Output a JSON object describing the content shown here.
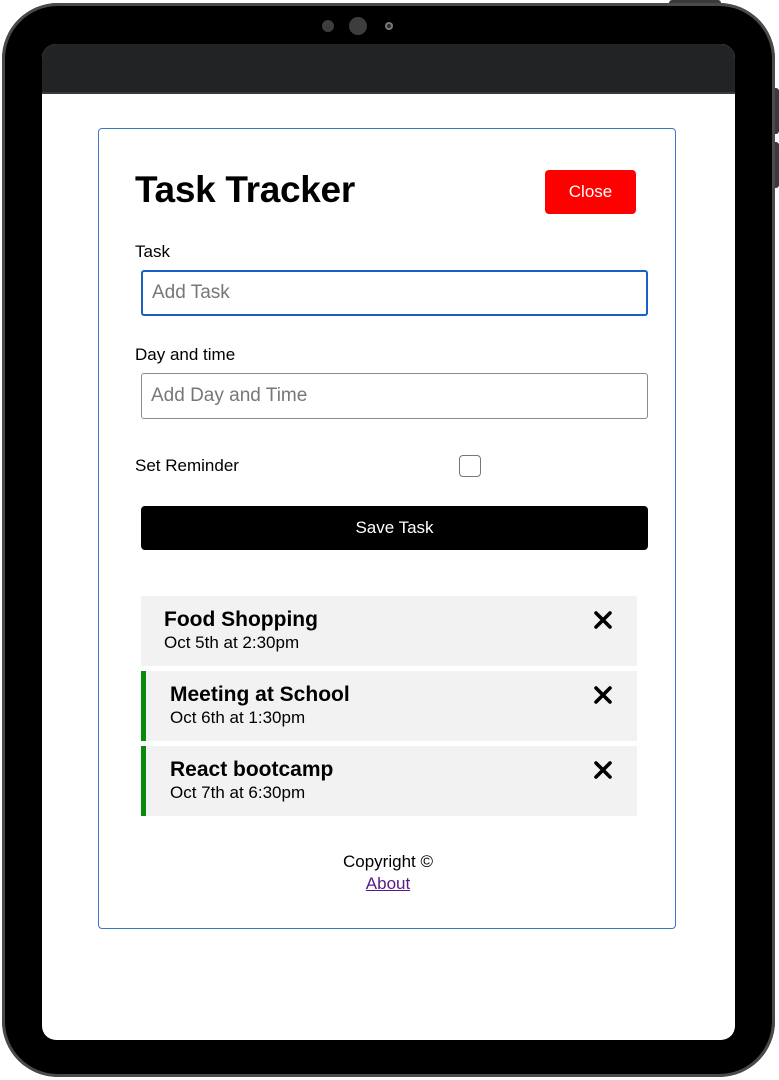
{
  "app": {
    "title": "Task Tracker",
    "close_label": "Close"
  },
  "form": {
    "task_label": "Task",
    "task_placeholder": "Add Task",
    "task_value": "",
    "day_label": "Day and time",
    "day_placeholder": "Add Day and Time",
    "day_value": "",
    "reminder_label": "Set Reminder",
    "reminder_checked": false,
    "save_label": "Save Task"
  },
  "tasks": [
    {
      "text": "Food Shopping",
      "day": "Oct 5th at 2:30pm",
      "reminder": false
    },
    {
      "text": "Meeting at School",
      "day": "Oct 6th at 1:30pm",
      "reminder": true
    },
    {
      "text": "React bootcamp",
      "day": "Oct 7th at 6:30pm",
      "reminder": true
    }
  ],
  "footer": {
    "copyright": "Copyright ©",
    "about_label": "About"
  },
  "colors": {
    "close_button": "#ff0000",
    "save_button": "#000000",
    "reminder_border": "#0a8a0a",
    "task_background": "#f2f2f2",
    "container_border": "#3b78c4"
  },
  "icons": {
    "delete": "close-icon"
  }
}
